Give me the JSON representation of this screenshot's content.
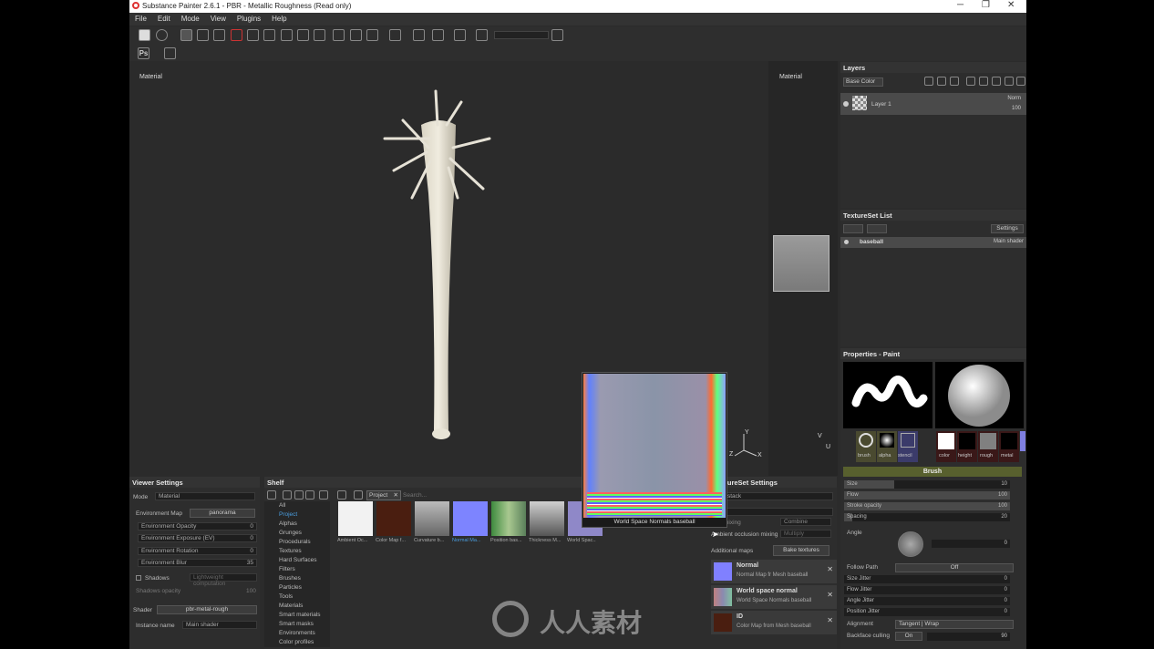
{
  "window": {
    "title": "Substance Painter 2.6.1 - PBR - Metallic Roughness (Read only)",
    "minimize": "─",
    "restore": "❐",
    "close": "✕"
  },
  "menu": [
    "File",
    "Edit",
    "Mode",
    "View",
    "Plugins",
    "Help"
  ],
  "toolbar": {
    "ps_label": "Ps"
  },
  "viewport3d": {
    "label": "Material",
    "axes": {
      "x": "X",
      "y": "Y",
      "z": "Z"
    }
  },
  "viewport2d": {
    "label": "Material",
    "axes": {
      "u": "U",
      "v": "V"
    }
  },
  "tooltip": "World Space Normals baseball",
  "layers": {
    "title": "Layers",
    "channel": "Base Color",
    "items": [
      {
        "name": "Layer 1",
        "blend": "Norm",
        "opacity": "100"
      }
    ]
  },
  "textureset_list": {
    "title": "TextureSet List",
    "settings": "Settings",
    "items": [
      {
        "name": "baseball",
        "shader": "Main shader"
      }
    ]
  },
  "properties": {
    "title": "Properties - Paint",
    "slots": [
      "brush",
      "alpha",
      "stencil"
    ],
    "channels": [
      "color",
      "height",
      "rough",
      "metal"
    ],
    "section": "Brush",
    "sliders": [
      {
        "label": "Size",
        "value": "10",
        "fill": 0.3
      },
      {
        "label": "Flow",
        "value": "100",
        "fill": 1.0
      },
      {
        "label": "Stroke opacity",
        "value": "100",
        "fill": 1.0
      },
      {
        "label": "Spacing",
        "value": "20",
        "fill": 0.05
      }
    ],
    "angle_label": "Angle",
    "angle_value": "0",
    "follow_path_label": "Follow Path",
    "follow_path_value": "Off",
    "jitters": [
      {
        "label": "Size Jitter",
        "value": "0"
      },
      {
        "label": "Flow Jitter",
        "value": "0"
      },
      {
        "label": "Angle Jitter",
        "value": "0"
      },
      {
        "label": "Position Jitter",
        "value": "0"
      }
    ],
    "alignment_label": "Alignment",
    "alignment_value": "Tangent | Wrap",
    "backface_label": "Backface culling",
    "backface_value": "On",
    "backface_num": "90"
  },
  "viewer_settings": {
    "title": "Viewer Settings",
    "mode_label": "Mode",
    "mode_value": "Material",
    "envmap_label": "Environment Map",
    "envmap_value": "panorama",
    "sliders": [
      {
        "label": "Environment Opacity",
        "value": "0"
      },
      {
        "label": "Environment Exposure (EV)",
        "value": "0"
      },
      {
        "label": "Environment Rotation",
        "value": "0"
      },
      {
        "label": "Environment Blur",
        "value": "35"
      }
    ],
    "shadows_label": "Shadows",
    "shadows_value": "Lightweight computation",
    "shadows_opacity_label": "Shadows opacity",
    "shadows_opacity_value": "100",
    "shader_label": "Shader",
    "shader_value": "pbr-metal-rough",
    "instance_label": "Instance name",
    "instance_value": "Main shader"
  },
  "shelf": {
    "title": "Shelf",
    "categories": [
      "All",
      "Project",
      "Alphas",
      "Grunges",
      "Procedurals",
      "Textures",
      "Hard Surfaces",
      "Filters",
      "Brushes",
      "Particles",
      "Tools",
      "Materials",
      "Smart materials",
      "Smart masks",
      "Environments",
      "Color profiles"
    ],
    "selected": "Project",
    "filter_tag": "Project",
    "search_placeholder": "Search...",
    "items": [
      {
        "label": "Ambient Oc...",
        "color": "#f2f2f2"
      },
      {
        "label": "Color Map f...",
        "color": "#4a1e10"
      },
      {
        "label": "Curvature b...",
        "color": "#8a8a8a"
      },
      {
        "label": "Normal Ma...",
        "color": "#7d84ff"
      },
      {
        "label": "Position bas...",
        "color": "#6aa86a"
      },
      {
        "label": "Thickness M...",
        "color": "#9a9a9a"
      },
      {
        "label": "World Spac...",
        "color": "#8f88c8"
      }
    ]
  },
  "textureset_settings": {
    "title": "TextureSet Settings",
    "stack_label": "stack",
    "normal_mixing_label": "mixing",
    "normal_mixing_value": "Combine",
    "ao_mixing_label": "Ambient occlusion mixing",
    "ao_mixing_value": "Multiply",
    "additional_label": "Additional maps",
    "bake_button": "Bake textures",
    "maps": [
      {
        "name": "Normal",
        "desc": "Normal Map fr    Mesh baseball",
        "color": "#8080ff"
      },
      {
        "name": "World space normal",
        "desc": "World Space Normals baseball",
        "color": "#8a8ab0"
      },
      {
        "name": "ID",
        "desc": "Color Map from Mesh baseball",
        "color": "#4a1e10"
      }
    ]
  },
  "watermark": "人人素材"
}
